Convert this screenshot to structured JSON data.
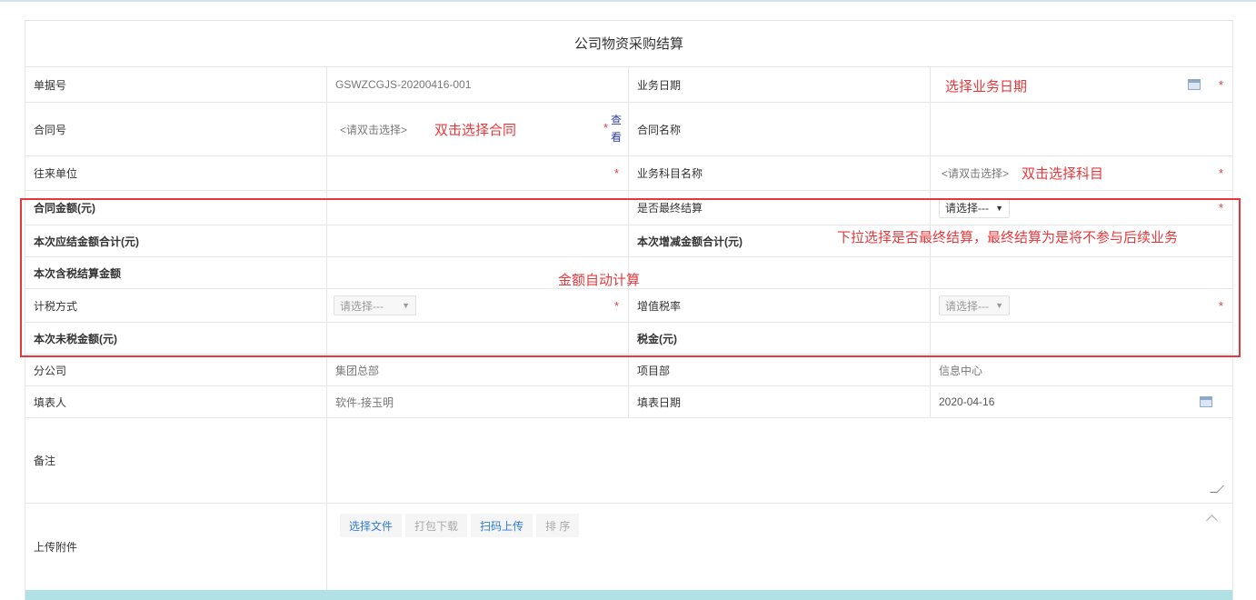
{
  "title": "公司物资采购结算",
  "fields": {
    "bill_no_label": "单据号",
    "bill_no_value": "GSWZCGJS-20200416-001",
    "biz_date_label": "业务日期",
    "biz_date_hint": "选择业务日期",
    "contract_no_label": "合同号",
    "contract_no_placeholder": "<请双击选择>",
    "contract_no_hint": "双击选择合同",
    "view_label": "查看",
    "contract_name_label": "合同名称",
    "partner_label": "往来单位",
    "subject_label": "业务科目名称",
    "subject_placeholder": "<请双击选择>",
    "subject_hint": "双击选择科目",
    "contract_amount_label": "合同金额(元)",
    "final_settle_label": "是否最终结算",
    "final_settle_value": "请选择---",
    "settle_total_label": "本次应结金额合计(元)",
    "change_total_label": "本次增减金额合计(元)",
    "final_settle_hint": "下拉选择是否最终结算，最终结算为是将不参与后续业务",
    "tax_incl_label": "本次含税结算金额",
    "auto_calc_hint": "金额自动计算",
    "tax_method_label": "计税方式",
    "tax_method_value": "请选择---",
    "vat_rate_label": "增值税率",
    "vat_rate_value": "请选择---",
    "tax_excl_label": "本次未税金额(元)",
    "tax_label": "税金(元)",
    "branch_label": "分公司",
    "branch_value": "集团总部",
    "project_label": "项目部",
    "project_value": "信息中心",
    "filler_label": "填表人",
    "filler_value": "软件-接玉明",
    "fill_date_label": "填表日期",
    "fill_date_value": "2020-04-16",
    "remark_label": "备注",
    "attach_label": "上传附件"
  },
  "attach_buttons": {
    "select_file": "选择文件",
    "pack_download": "打包下载",
    "scan_upload": "扫码上传",
    "sort": "排 序"
  },
  "required_mark": "*",
  "colors": {
    "required": "#e4393c",
    "annotation": "#e4393c",
    "link": "#2e7bd6",
    "bottom_bar": "#b1e0e5"
  }
}
